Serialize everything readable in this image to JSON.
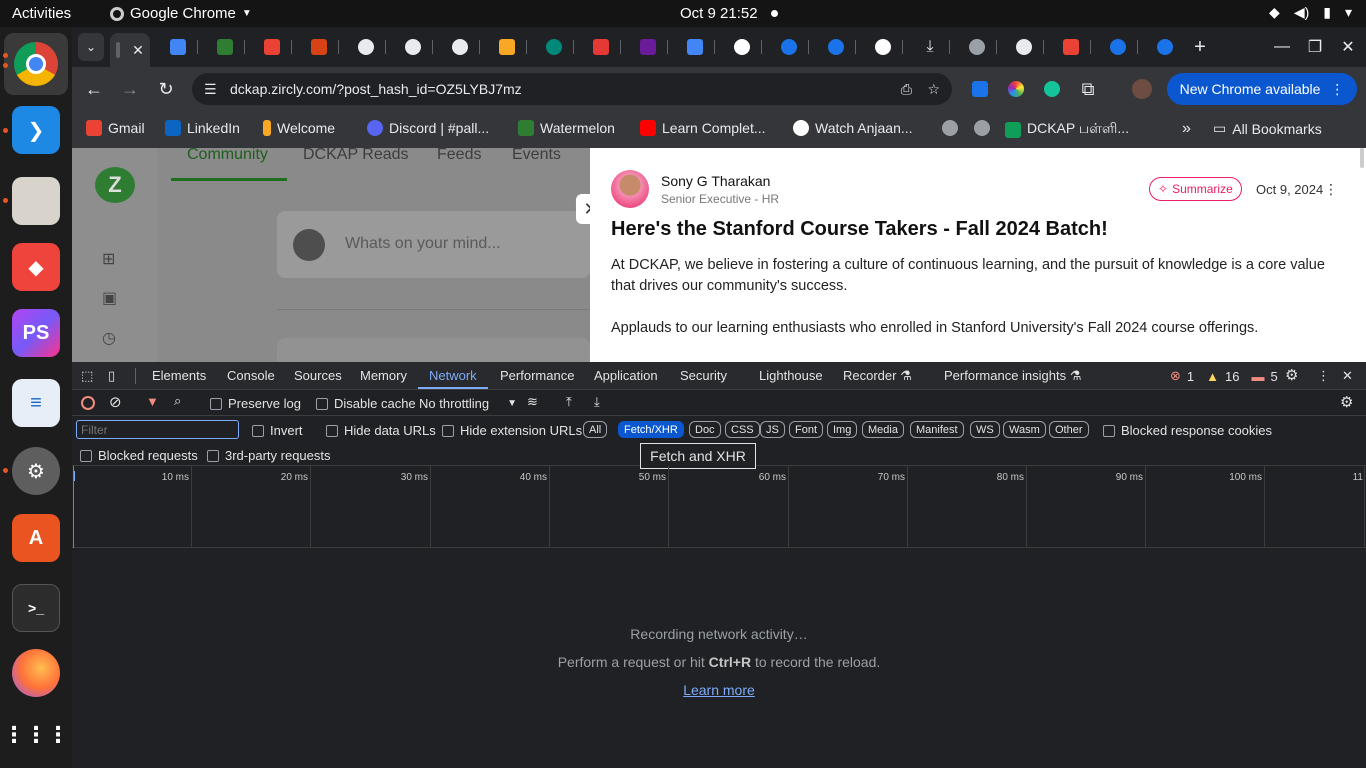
{
  "system": {
    "activities": "Activities",
    "app_name": "Google Chrome",
    "clock": "Oct 9  21:52"
  },
  "dock": {
    "apps": [
      "chrome-icon",
      "vscode-icon",
      "files-icon",
      "anydesk-icon",
      "phpstorm-icon",
      "text-editor-icon",
      "settings-icon",
      "app-center-icon",
      "terminal-icon",
      "firefox-icon",
      "show-apps-icon"
    ]
  },
  "browser": {
    "url": "dckap.zircly.com/?post_hash_id=OZ5LYBJ7mz",
    "new_chrome": "New Chrome available",
    "bookmarks": [
      {
        "label": "Gmail",
        "color": "#ea4335"
      },
      {
        "label": "LinkedIn",
        "color": "#0a66c2"
      },
      {
        "label": "Welcome",
        "color": "#f9a825"
      },
      {
        "label": "Discord | #pall...",
        "color": "#5865f2"
      },
      {
        "label": "Watermelon",
        "color": "#2e7d32"
      },
      {
        "label": "Learn Complet...",
        "color": "#ff0000"
      },
      {
        "label": "Watch Anjaan...",
        "color": "#4285f4"
      },
      {
        "label": "",
        "color": "#9aa0a6"
      },
      {
        "label": "",
        "color": "#9aa0a6"
      },
      {
        "label": "DCKAP பள்ளி...",
        "color": "#0f9d58"
      }
    ],
    "all_bookmarks": "All Bookmarks"
  },
  "page": {
    "nav_tabs": [
      "Community",
      "DCKAP Reads",
      "Feeds",
      "Events"
    ],
    "post_placeholder": "Whats on your mind...",
    "post": {
      "author": "Sony G Tharakan",
      "role": "Senior Executive - HR",
      "summarize": "Summarize",
      "date": "Oct 9, 2024",
      "title": "Here's the Stanford Course Takers - Fall 2024 Batch!",
      "para1": "At DCKAP, we believe in fostering a culture of continuous learning, and the pursuit of knowledge is a core value that drives our community's success.",
      "para2": "Applauds to our learning enthusiasts who enrolled in Stanford University's Fall 2024 course offerings."
    }
  },
  "devtools": {
    "tabs": [
      "Elements",
      "Console",
      "Sources",
      "Memory",
      "Network",
      "Performance",
      "Application",
      "Security",
      "Lighthouse",
      "Recorder ⚗",
      "Performance insights ⚗"
    ],
    "active_tab": "Network",
    "errors": "1",
    "warnings": "16",
    "issues": "5",
    "preserve_log": "Preserve log",
    "disable_cache": "Disable cache",
    "throttling": "No throttling",
    "filter_placeholder": "Filter",
    "invert": "Invert",
    "hide_data_urls": "Hide data URLs",
    "hide_extension_urls": "Hide extension URLs",
    "type_filters": [
      "All",
      "Fetch/XHR",
      "Doc",
      "CSS",
      "JS",
      "Font",
      "Img",
      "Media",
      "Manifest",
      "WS",
      "Wasm",
      "Other"
    ],
    "selected_filter": "Fetch/XHR",
    "blocked_response_cookies": "Blocked response cookies",
    "blocked_requests": "Blocked requests",
    "third_party": "3rd-party requests",
    "tooltip": "Fetch and XHR",
    "timeline_ticks": [
      "10 ms",
      "20 ms",
      "30 ms",
      "40 ms",
      "50 ms",
      "60 ms",
      "70 ms",
      "80 ms",
      "90 ms",
      "100 ms",
      "11"
    ],
    "empty_title": "Recording network activity…",
    "empty_hint_before": "Perform a request or hit",
    "empty_hint_key": "Ctrl+R",
    "empty_hint_after": "to record the reload.",
    "learn_more": "Learn more"
  }
}
